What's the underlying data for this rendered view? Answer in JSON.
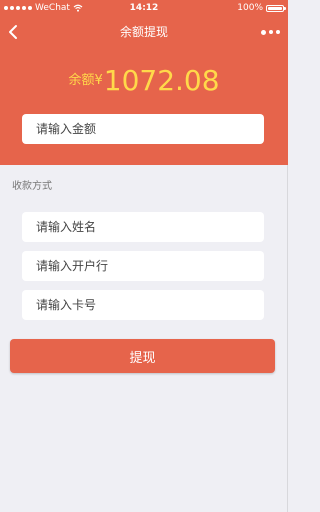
{
  "status_bar": {
    "carrier": "WeChat",
    "time": "14:12",
    "battery": "100%"
  },
  "nav": {
    "title": "余额提现"
  },
  "balance": {
    "label": "余额",
    "currency": "¥",
    "amount": "1072.08"
  },
  "form": {
    "amount_placeholder": "请输入金额",
    "section_label": "收款方式",
    "name_placeholder": "请输入姓名",
    "bank_placeholder": "请输入开户行",
    "card_placeholder": "请输入卡号",
    "submit_label": "提现"
  },
  "colors": {
    "brand": "#e6644b",
    "highlight": "#ffd94a",
    "background": "#efeff4"
  }
}
